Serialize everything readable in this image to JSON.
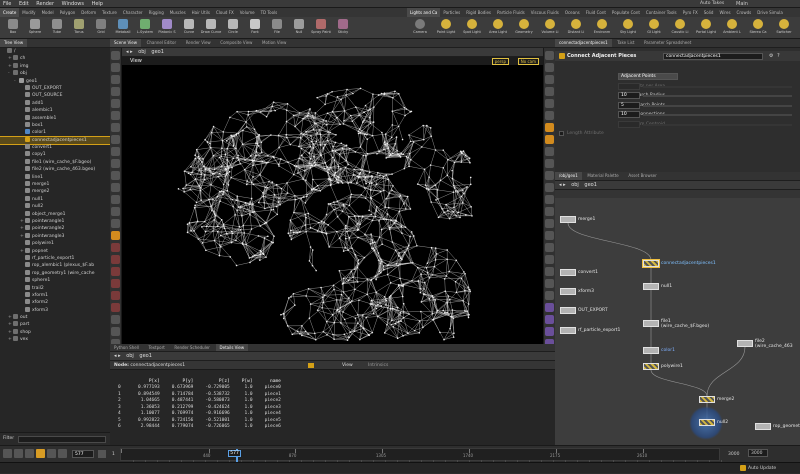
{
  "menubar": {
    "items": [
      "File",
      "Edit",
      "Render",
      "Windows",
      "Help"
    ],
    "desktop": "Main"
  },
  "shelf": {
    "tabs_left": [
      "Create",
      "Modify",
      "Model",
      "Polygon",
      "Deform",
      "Texture",
      "Character",
      "Rigging",
      "Muscles",
      "Hair Utils",
      "Cloud FX",
      "Volume",
      "TD Tools"
    ],
    "tabs_right": [
      "Lights and Ca",
      "Particles",
      "Rigid Bodies",
      "Particle Fluids",
      "Viscous Fluids",
      "Oceans",
      "Fluid Cont",
      "Populate Cont",
      "Container Tools",
      "Pyro FX",
      "Solid",
      "Wires",
      "Crowds",
      "Drive Simula"
    ],
    "tools_left": [
      "Box",
      "Sphere",
      "Tube",
      "Torus",
      "Grid",
      "Metaball",
      "L-System",
      "Platonic S",
      "Curve",
      "Draw Curve",
      "Circle",
      "Font",
      "File",
      "Null",
      "Spray Paint",
      "Sticky"
    ],
    "tools_right": [
      "Camera",
      "Point Light",
      "Spot Light",
      "Area Light",
      "Geometry",
      "Volume Li",
      "Distant Li",
      "Environm",
      "Sky Light",
      "GI Light",
      "Caustic Li",
      "Portal Light",
      "Ambient L",
      "Stereo Ca",
      "Switcher"
    ],
    "auto_takes": "Auto Takes"
  },
  "left_pane": {
    "tabs": [
      "Tree View"
    ],
    "items": [
      {
        "label": "/",
        "depth": 0,
        "expander": "",
        "color": "#6f6f6f"
      },
      {
        "label": "ch",
        "depth": 1,
        "expander": "+",
        "color": "#6f6f6f"
      },
      {
        "label": "img",
        "depth": 1,
        "expander": "+",
        "color": "#6f6f6f"
      },
      {
        "label": "obj",
        "depth": 1,
        "expander": "-",
        "color": "#6f6f6f"
      },
      {
        "label": "geo1",
        "depth": 2,
        "expander": "-",
        "color": "#9c9c9c"
      },
      {
        "label": "OUT_EXPORT",
        "depth": 3,
        "expander": "",
        "color": "#8a8a8a"
      },
      {
        "label": "OUT_SOURCE",
        "depth": 3,
        "expander": "",
        "color": "#8a8a8a"
      },
      {
        "label": "add1",
        "depth": 3,
        "expander": "",
        "color": "#8a8a8a"
      },
      {
        "label": "alembic1",
        "depth": 3,
        "expander": "",
        "color": "#8a8a8a"
      },
      {
        "label": "assemble1",
        "depth": 3,
        "expander": "",
        "color": "#8a8a8a"
      },
      {
        "label": "box1",
        "depth": 3,
        "expander": "",
        "color": "#8a8a8a"
      },
      {
        "label": "color1",
        "depth": 3,
        "expander": "",
        "color": "#4f86c6"
      },
      {
        "label": "connectadjacentpieces1",
        "depth": 3,
        "expander": "",
        "color": "#d4a017",
        "selected": true
      },
      {
        "label": "convert1",
        "depth": 3,
        "expander": "",
        "color": "#8a8a8a"
      },
      {
        "label": "copy1",
        "depth": 3,
        "expander": "",
        "color": "#8a8a8a"
      },
      {
        "label": "file1 (wire_cache_$F.bgeo)",
        "depth": 3,
        "expander": "",
        "color": "#8a8a8a"
      },
      {
        "label": "file2 (wire_cache_463.bgeo)",
        "depth": 3,
        "expander": "",
        "color": "#8a8a8a"
      },
      {
        "label": "line1",
        "depth": 3,
        "expander": "",
        "color": "#8a8a8a"
      },
      {
        "label": "merge1",
        "depth": 3,
        "expander": "",
        "color": "#8a8a8a"
      },
      {
        "label": "merge2",
        "depth": 3,
        "expander": "",
        "color": "#8a8a8a"
      },
      {
        "label": "null1",
        "depth": 3,
        "expander": "",
        "color": "#8a8a8a"
      },
      {
        "label": "null2",
        "depth": 3,
        "expander": "",
        "color": "#8a8a8a"
      },
      {
        "label": "object_merge1",
        "depth": 3,
        "expander": "",
        "color": "#8a8a8a"
      },
      {
        "label": "pointwrangle1",
        "depth": 3,
        "expander": "+",
        "color": "#8a8a8a"
      },
      {
        "label": "pointwrangle2",
        "depth": 3,
        "expander": "+",
        "color": "#8a8a8a"
      },
      {
        "label": "pointwrangle3",
        "depth": 3,
        "expander": "+",
        "color": "#8a8a8a"
      },
      {
        "label": "polywire1",
        "depth": 3,
        "expander": "",
        "color": "#8a8a8a"
      },
      {
        "label": "popnet",
        "depth": 3,
        "expander": "+",
        "color": "#8a8a8a"
      },
      {
        "label": "rf_particle_export1",
        "depth": 3,
        "expander": "",
        "color": "#8a8a8a"
      },
      {
        "label": "rop_alembic1 (plexus_$F.ab",
        "depth": 3,
        "expander": "",
        "color": "#8a8a8a"
      },
      {
        "label": "rop_geometry1 (wire_cache",
        "depth": 3,
        "expander": "",
        "color": "#8a8a8a"
      },
      {
        "label": "sphere1",
        "depth": 3,
        "expander": "",
        "color": "#8a8a8a"
      },
      {
        "label": "trail2",
        "depth": 3,
        "expander": "",
        "color": "#8a8a8a"
      },
      {
        "label": "xform1",
        "depth": 3,
        "expander": "",
        "color": "#8a8a8a"
      },
      {
        "label": "xform2",
        "depth": 3,
        "expander": "",
        "color": "#8a8a8a"
      },
      {
        "label": "xform3",
        "depth": 3,
        "expander": "",
        "color": "#8a8a8a"
      },
      {
        "label": "out",
        "depth": 1,
        "expander": "+",
        "color": "#6f6f6f"
      },
      {
        "label": "part",
        "depth": 1,
        "expander": "+",
        "color": "#6f6f6f"
      },
      {
        "label": "shop",
        "depth": 1,
        "expander": "+",
        "color": "#6f6f6f"
      },
      {
        "label": "vex",
        "depth": 1,
        "expander": "+",
        "color": "#6f6f6f"
      }
    ],
    "filter_label": "Filter"
  },
  "viewport_pane": {
    "tabs": [
      "Scene View",
      "Channel Editor",
      "Render View",
      "Composite View",
      "Motion View"
    ],
    "path": [
      "obj",
      "geo1"
    ],
    "header": "View",
    "camera_menu": "persp",
    "camera_menu2": "No cam"
  },
  "param_pane": {
    "tabs": [
      "connectadjacentpieces1",
      "Take List",
      "Parameter Spreadsheet"
    ],
    "node_type": "Connect Adjacent Pieces",
    "node_name": "connectadjacentpieces1",
    "rows": [
      {
        "label": "Connection Type",
        "value": "Adjacent Points",
        "kind": "menu",
        "disabled": false
      },
      {
        "label": "Points per Area",
        "value": "",
        "kind": "blank",
        "disabled": true
      },
      {
        "label": "Search Radius",
        "value": "10",
        "kind": "num",
        "disabled": false
      },
      {
        "label": "Max Search Points",
        "value": "5",
        "kind": "num",
        "disabled": false
      },
      {
        "label": "Max Connections",
        "value": "10",
        "kind": "num",
        "disabled": false
      },
      {
        "label": "Offset From Centroid",
        "value": "",
        "kind": "blank",
        "disabled": true
      },
      {
        "label": "Length Attribute",
        "value": "",
        "kind": "check",
        "disabled": true
      }
    ]
  },
  "network_pane": {
    "tabs": [
      "/obj/geo1",
      "Material Palette",
      "Asset Browser"
    ],
    "path": [
      "obj",
      "geo1"
    ],
    "nodes": [
      {
        "label": "merge1",
        "style": "plain"
      },
      {
        "label": "convert1",
        "style": "plain"
      },
      {
        "label": "connectadjacentpieces1",
        "style": "hatched",
        "selected": true
      },
      {
        "label": "null1",
        "style": "plain"
      },
      {
        "label": "xform3",
        "style": "plain"
      },
      {
        "label": "OUT_EXPORT",
        "style": "plain"
      },
      {
        "label": "rf_particle_export1",
        "style": "plain"
      },
      {
        "label": "file1\n(wire_cache_$F.bgeo)",
        "style": "plain"
      },
      {
        "label": "color1",
        "style": "plain"
      },
      {
        "label": "file2\n(wire_cache_463",
        "style": "plain"
      },
      {
        "label": "polywire1",
        "style": "hatched"
      },
      {
        "label": "merge2",
        "style": "hatched"
      },
      {
        "label": "null2",
        "style": "hatched"
      },
      {
        "label": "rop_geometry1 (wire",
        "style": "plain"
      }
    ]
  },
  "spreadsheet_pane": {
    "tabs": [
      "Python Shell",
      "Textport",
      "Render Scheduler",
      "Details View"
    ],
    "path": [
      "obj",
      "geo1"
    ],
    "node_label": "Node:",
    "node_name": "connectadjacentpieces1",
    "view_label": "View",
    "intrinsics_label": "Intrinsics",
    "columns": [
      "",
      "P[x]",
      "P[y]",
      "P[z]",
      "P[w]",
      "name"
    ],
    "rows": [
      [
        "0",
        "0.977193",
        "0.673969",
        "-0.729005",
        "1.0",
        "piece0"
      ],
      [
        "1",
        "0.894549",
        "0.714784",
        "-0.538732",
        "1.0",
        "piece1"
      ],
      [
        "2",
        "1.04665",
        "0.487441",
        "-0.580873",
        "1.0",
        "piece2"
      ],
      [
        "3",
        "1.36053",
        "0.212799",
        "-0.424624",
        "1.0",
        "piece3"
      ],
      [
        "4",
        "1.10077",
        "0.769974",
        "-0.916696",
        "1.0",
        "piece4"
      ],
      [
        "5",
        "0.992822",
        "0.724156",
        "-0.521001",
        "1.0",
        "piece5"
      ],
      [
        "6",
        "2.98444",
        "0.779074",
        "-0.726065",
        "1.0",
        "piece6"
      ]
    ]
  },
  "timeline": {
    "start": "1",
    "current_frame": "577",
    "frame_field": "577",
    "ticks": [
      "1",
      "440",
      "870",
      "1305",
      "1740",
      "2175",
      "2610"
    ],
    "end": "3000",
    "end2": "3000"
  },
  "status": {
    "auto_update": "Auto Update"
  }
}
